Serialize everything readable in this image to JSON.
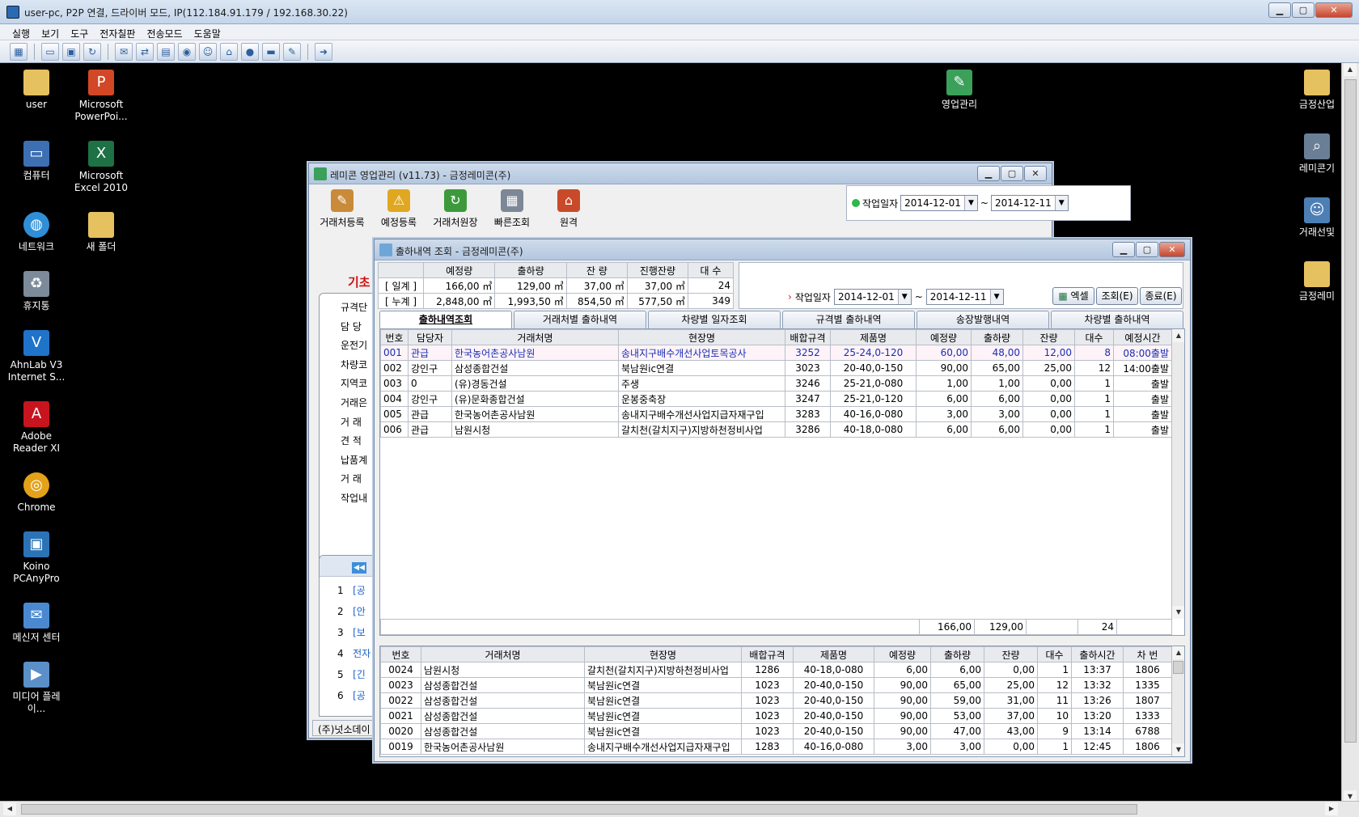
{
  "remote": {
    "title": "user-pc, P2P 연결, 드라이버 모드, IP(112.184.91.179 / 192.168.30.22)",
    "menu": [
      "실행",
      "보기",
      "도구",
      "전자칠판",
      "전송모드",
      "도움말"
    ]
  },
  "desktop": {
    "left_icons": [
      {
        "label": "user",
        "icon": "folder-icon"
      },
      {
        "label": "Microsoft PowerPoi...",
        "icon": "powerpoint-icon"
      },
      {
        "label": "컴퓨터",
        "icon": "computer-icon"
      },
      {
        "label": "Microsoft Excel 2010",
        "icon": "excel-icon"
      },
      {
        "label": "네트워크",
        "icon": "network-icon"
      },
      {
        "label": "새 폴더",
        "icon": "folder-icon"
      },
      {
        "label": "휴지통",
        "icon": "recycle-bin-icon"
      },
      {
        "label": "AhnLab V3 Internet S...",
        "icon": "v3-icon"
      },
      {
        "label": "Adobe Reader XI",
        "icon": "adobe-icon"
      },
      {
        "label": "Chrome",
        "icon": "chrome-icon"
      },
      {
        "label": "Koino PCAnyPro",
        "icon": "pcanypro-icon"
      },
      {
        "label": "메신저 센터",
        "icon": "messenger-icon"
      },
      {
        "label": "미디어 플레이...",
        "icon": "media-player-icon"
      }
    ],
    "center_icon": "영업관리",
    "right_icons": [
      "금정산업",
      "레미콘기",
      "거래선및",
      "금정레미"
    ]
  },
  "main": {
    "title": "레미콘 영업관리 (v11.73) - 금정레미콘(주)",
    "toolbar": [
      "거래처등록",
      "예정등록",
      "거래처원장",
      "빠른조회",
      "원격"
    ],
    "date_label": "작업일자",
    "date_from": "2014-12-01",
    "tilde": "~",
    "date_to": "2014-12-11",
    "bg_heading": "기초",
    "bg_labels": [
      "규격단",
      "담 당 ",
      "운전기",
      "차량코",
      "지역코",
      "거래은",
      "거 래 ",
      "견 적 ",
      "납품계",
      "거 래 ",
      "작업내"
    ],
    "bg_list": [
      {
        "no": "1",
        "text": "[공"
      },
      {
        "no": "2",
        "text": "[안"
      },
      {
        "no": "3",
        "text": "[보"
      },
      {
        "no": "4",
        "text": "전자"
      },
      {
        "no": "5",
        "text": "[긴"
      },
      {
        "no": "6",
        "text": "[공"
      }
    ],
    "status": "(주)넛소데이"
  },
  "dlg": {
    "title": "출하내역 조회 - 금정레미콘(주)",
    "summary": {
      "headers": [
        "",
        "예정량",
        "출하량",
        "잔 량",
        "진행잔량",
        "대 수"
      ],
      "rows": [
        [
          "[ 일계 ]",
          "166,00 ㎥",
          "129,00 ㎥",
          "37,00 ㎥",
          "37,00 ㎥",
          "24"
        ],
        [
          "[ 누계 ]",
          "2,848,00 ㎥",
          "1,993,50 ㎥",
          "854,50 ㎥",
          "577,50 ㎥",
          "349"
        ]
      ]
    },
    "date_label": "작업일자",
    "date_from": "2014-12-01",
    "tilde": "~",
    "date_to": "2014-12-11",
    "buttons": {
      "excel": "엑셀",
      "search": "조회(E)",
      "close": "종료(E)"
    },
    "tabs": [
      "출하내역조회",
      "거래처별 출하내역",
      "차량별 일자조회",
      "규격별 출하내역",
      "송장발행내역",
      "차량별 출하내역"
    ],
    "grid1": {
      "headers": [
        "번호",
        "담당자",
        "거래처명",
        "현장명",
        "배합규격",
        "제품명",
        "예정량",
        "출하량",
        "잔량",
        "대수",
        "예정시간"
      ],
      "rows": [
        [
          "001",
          "관급",
          "한국농어촌공사남원",
          "송내지구배수개선사업토목공사",
          "3252",
          "25-24,0-120",
          "60,00",
          "48,00",
          "12,00",
          "8",
          "08:00출발"
        ],
        [
          "002",
          "강인구",
          "삼성종합건설",
          "북남원ic연결",
          "3023",
          "20-40,0-150",
          "90,00",
          "65,00",
          "25,00",
          "12",
          "14:00출발"
        ],
        [
          "003",
          "0",
          "(유)경동건설",
          "주생",
          "3246",
          "25-21,0-080",
          "1,00",
          "1,00",
          "0,00",
          "1",
          "출발"
        ],
        [
          "004",
          "강인구",
          "(유)문화종합건설",
          "운봉중축장",
          "3247",
          "25-21,0-120",
          "6,00",
          "6,00",
          "0,00",
          "1",
          "출발"
        ],
        [
          "005",
          "관급",
          "한국농어촌공사남원",
          "송내지구배수개선사업지급자재구입",
          "3283",
          "40-16,0-080",
          "3,00",
          "3,00",
          "0,00",
          "1",
          "출발"
        ],
        [
          "006",
          "관급",
          "남원시청",
          "갈치천(갈치지구)지방하천정비사업",
          "3286",
          "40-18,0-080",
          "6,00",
          "6,00",
          "0,00",
          "1",
          "출발"
        ]
      ],
      "totals": {
        "plan": "166,00",
        "ship": "129,00",
        "count": "24"
      }
    },
    "grid2": {
      "headers": [
        "번호",
        "거래처명",
        "현장명",
        "배합규격",
        "제품명",
        "예정량",
        "출하량",
        "잔량",
        "대수",
        "출하시간",
        "차 번"
      ],
      "rows": [
        [
          "0024",
          "남원시청",
          "갈치천(갈치지구)지방하천정비사업",
          "1286",
          "40-18,0-080",
          "6,00",
          "6,00",
          "0,00",
          "1",
          "13:37",
          "1806"
        ],
        [
          "0023",
          "삼성종합건설",
          "북남원ic연결",
          "1023",
          "20-40,0-150",
          "90,00",
          "65,00",
          "25,00",
          "12",
          "13:32",
          "1335"
        ],
        [
          "0022",
          "삼성종합건설",
          "북남원ic연결",
          "1023",
          "20-40,0-150",
          "90,00",
          "59,00",
          "31,00",
          "11",
          "13:26",
          "1807"
        ],
        [
          "0021",
          "삼성종합건설",
          "북남원ic연결",
          "1023",
          "20-40,0-150",
          "90,00",
          "53,00",
          "37,00",
          "10",
          "13:20",
          "1333"
        ],
        [
          "0020",
          "삼성종합건설",
          "북남원ic연결",
          "1023",
          "20-40,0-150",
          "90,00",
          "47,00",
          "43,00",
          "9",
          "13:14",
          "6788"
        ],
        [
          "0019",
          "한국농어촌공사남원",
          "송내지구배수개선사업지급자재구입",
          "1283",
          "40-16,0-080",
          "3,00",
          "3,00",
          "0,00",
          "1",
          "12:45",
          "1806"
        ]
      ]
    }
  }
}
